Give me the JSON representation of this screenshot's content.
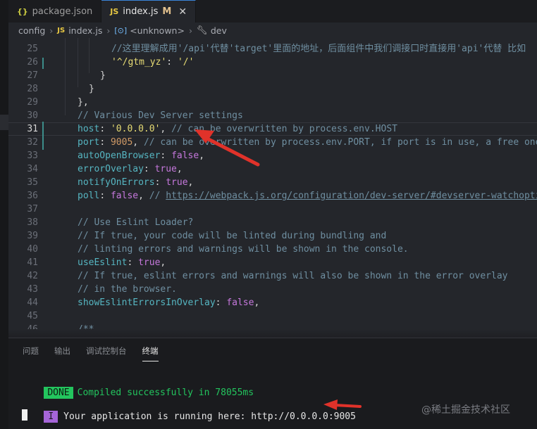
{
  "tabs": [
    {
      "icon": "{}",
      "label": "package.json",
      "active": false
    },
    {
      "icon": "JS",
      "label": "index.js",
      "modified": "M",
      "close": "✕",
      "active": true
    }
  ],
  "breadcrumb": {
    "items": [
      "config",
      "index.js",
      "<unknown>",
      "dev"
    ]
  },
  "editor": {
    "current_line": 31,
    "lines": [
      {
        "no": "25",
        "text": "//这里理解成用'/api'代替'target'里面的地址，后面组件中我们调接口时直接用'api'代替 比如"
      },
      {
        "no": "26",
        "key": "'^/gtm_yz'",
        "value": "'/'"
      },
      {
        "no": "27",
        "text": "}"
      },
      {
        "no": "28",
        "text": "}"
      },
      {
        "no": "29",
        "text": "},"
      },
      {
        "no": "30",
        "text": "// Various Dev Server settings"
      },
      {
        "no": "31",
        "key": "host",
        "value": "'0.0.0.0'",
        "comment": "// can be overwritten by process.env.HOST"
      },
      {
        "no": "32",
        "key": "port",
        "value": "9005",
        "comment": "// can be overwritten by process.env.PORT, if port is in use, a free one wi"
      },
      {
        "no": "33",
        "key": "autoOpenBrowser",
        "value": "false"
      },
      {
        "no": "34",
        "key": "errorOverlay",
        "value": "true"
      },
      {
        "no": "35",
        "key": "notifyOnErrors",
        "value": "true"
      },
      {
        "no": "36",
        "key": "poll",
        "value": "false",
        "comment_prefix": "// ",
        "link": "https://webpack.js.org/configuration/dev-server/#devserver-watchoptions"
      },
      {
        "no": "37",
        "text": ""
      },
      {
        "no": "38",
        "text": "// Use Eslint Loader?"
      },
      {
        "no": "39",
        "text": "// If true, your code will be linted during bundling and"
      },
      {
        "no": "40",
        "text": "// linting errors and warnings will be shown in the console."
      },
      {
        "no": "41",
        "key": "useEslint",
        "value": "true"
      },
      {
        "no": "42",
        "text": "// If true, eslint errors and warnings will also be shown in the error overlay"
      },
      {
        "no": "43",
        "text": "// in the browser."
      },
      {
        "no": "44",
        "key": "showEslintErrorsInOverlay",
        "value": "false"
      },
      {
        "no": "45",
        "text": ""
      },
      {
        "no": "46",
        "text": "/**"
      }
    ]
  },
  "panel": {
    "tabs": [
      "问题",
      "输出",
      "调试控制台",
      "终端"
    ],
    "active_tab": "终端",
    "done_badge": "DONE",
    "done_text": "Compiled successfully in 78055ms",
    "info_badge": "I",
    "info_text": "Your application is running here: http://0.0.0.0:9005"
  },
  "watermark": "@稀土掘金技术社区",
  "colors": {
    "accent": "#3a84d8",
    "done": "#23c55e",
    "info": "#a565d8",
    "arrow": "#e0322a"
  },
  "icons": {
    "json": "braces-icon",
    "js": "js-file-icon",
    "symbol": "symbol-icon",
    "wrench": "wrench-icon"
  }
}
